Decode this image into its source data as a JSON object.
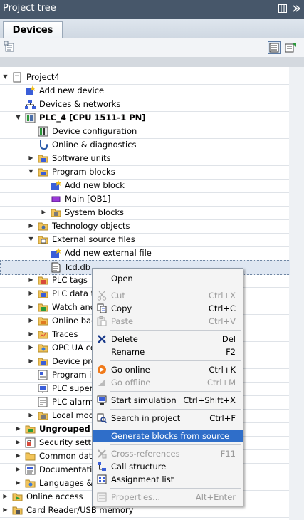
{
  "panel": {
    "title": "Project tree"
  },
  "tabs": [
    {
      "label": "Devices"
    }
  ],
  "tree": {
    "project": "Project4",
    "add_new_device": "Add new device",
    "devices_networks": "Devices & networks",
    "plc": "PLC_4 [CPU 1511-1 PN]",
    "device_configuration": "Device configuration",
    "online_diagnostics": "Online & diagnostics",
    "software_units": "Software units",
    "program_blocks": "Program blocks",
    "add_new_block": "Add new block",
    "main_ob1": "Main [OB1]",
    "system_blocks": "System blocks",
    "technology_objects": "Technology objects",
    "external_source_files": "External source files",
    "add_new_external_file": "Add new external file",
    "lcd_db": "lcd.db",
    "plc_tags": "PLC tags",
    "plc_data_types": "PLC data ty",
    "watch_force": "Watch and",
    "online_backups": "Online bac",
    "traces": "Traces",
    "opc_ua": "OPC UA co",
    "device_proxy": "Device pro",
    "program_info": "Program in",
    "plc_supervision": "PLC superv",
    "plc_alarm": "PLC alarm",
    "local_modules": "Local mod",
    "ungrouped_devices": "Ungrouped de",
    "security_settings": "Security settin",
    "common_data": "Common data",
    "documentation": "Documentatio",
    "languages": "Languages &",
    "online_access": "Online access",
    "card_reader": "Card Reader/USB memory"
  },
  "context_menu": {
    "open": "Open",
    "cut": "Cut",
    "cut_sc": "Ctrl+X",
    "copy": "Copy",
    "copy_sc": "Ctrl+C",
    "paste": "Paste",
    "paste_sc": "Ctrl+V",
    "delete": "Delete",
    "delete_sc": "Del",
    "rename": "Rename",
    "rename_sc": "F2",
    "go_online": "Go online",
    "go_online_sc": "Ctrl+K",
    "go_offline": "Go offline",
    "go_offline_sc": "Ctrl+M",
    "start_simulation": "Start simulation",
    "start_simulation_sc": "Ctrl+Shift+X",
    "search_in_project": "Search in project",
    "search_in_project_sc": "Ctrl+F",
    "generate_blocks": "Generate blocks from source",
    "cross_references": "Cross-references",
    "cross_references_sc": "F11",
    "call_structure": "Call structure",
    "assignment_list": "Assignment list",
    "properties": "Properties...",
    "properties_sc": "Alt+Enter"
  },
  "colors": {
    "titlebar": "#47576a",
    "menu_highlight": "#2f6ec9",
    "selection": "#dfe7f2"
  }
}
